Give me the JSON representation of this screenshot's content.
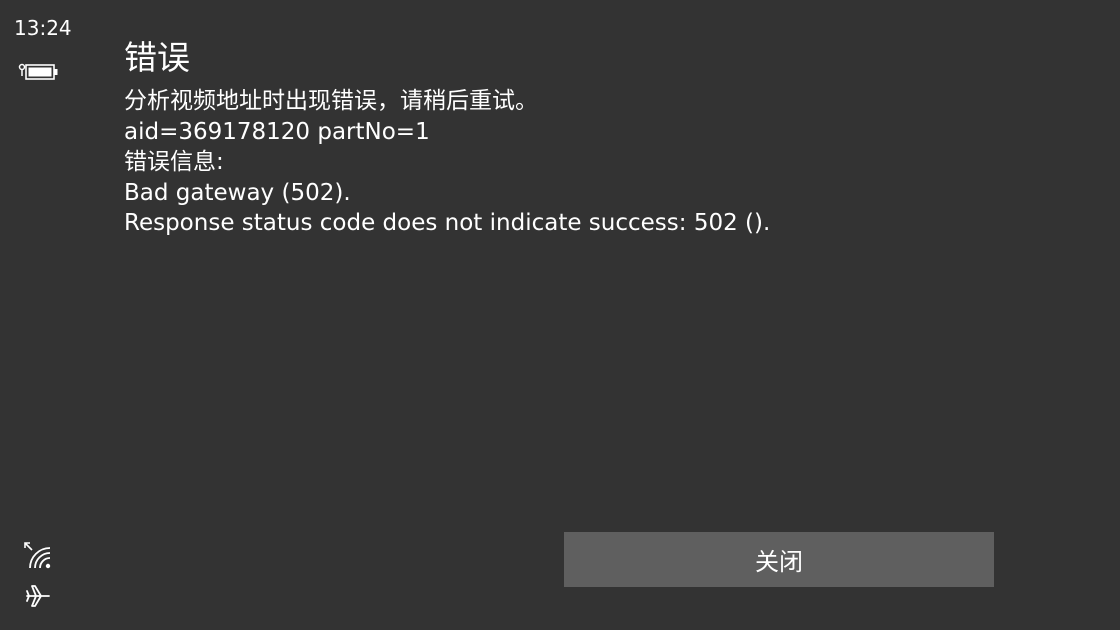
{
  "status_bar": {
    "time": "13:24",
    "battery_icon": "battery-icon",
    "wifi_icon": "wifi-icon",
    "airplane_icon": "airplane-mode-icon"
  },
  "dialog": {
    "title": "错误",
    "lines": [
      "分析视频地址时出现错误，请稍后重试。",
      "aid=369178120 partNo=1",
      "错误信息:",
      "Bad gateway (502).",
      "Response status code does not indicate success: 502 ()."
    ],
    "close_label": "关闭"
  },
  "colors": {
    "background": "#333333",
    "button": "#5f5f5f",
    "text": "#ffffff"
  }
}
